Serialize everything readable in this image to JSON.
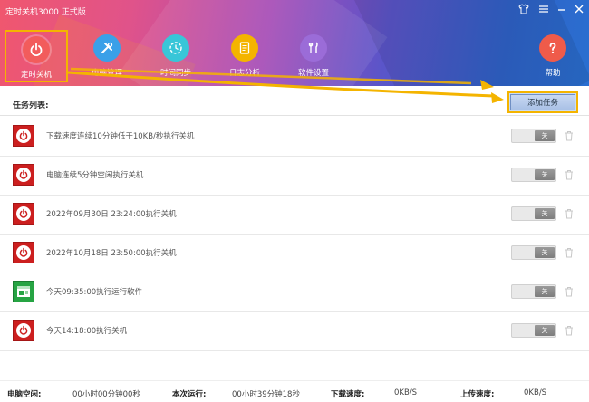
{
  "window": {
    "title": "定时关机3000 正式版",
    "controls": [
      "shirt-icon",
      "menu-icon",
      "minimize-icon",
      "close-icon"
    ]
  },
  "nav": [
    {
      "id": "shutdown",
      "label": "定时关机",
      "icon": "power-icon",
      "active": true
    },
    {
      "id": "pc",
      "label": "电脑管理",
      "icon": "tools-icon"
    },
    {
      "id": "timesync",
      "label": "时间同步",
      "icon": "clock-sync-icon"
    },
    {
      "id": "log",
      "label": "日志分析",
      "icon": "log-doc-icon"
    },
    {
      "id": "settings",
      "label": "软件设置",
      "icon": "wrench-spoon-icon"
    },
    {
      "id": "help",
      "label": "帮助",
      "icon": "question-icon"
    }
  ],
  "task_list": {
    "title": "任务列表:",
    "add_button": "添加任务",
    "rows": [
      {
        "type": "power",
        "text": "下载速度连续10分钟低于10KB/秒执行关机",
        "toggle": "关"
      },
      {
        "type": "power",
        "text": "电脑连续5分钟空闲执行关机",
        "toggle": "关"
      },
      {
        "type": "power",
        "text": "2022年09月30日 23:24:00执行关机",
        "toggle": "关"
      },
      {
        "type": "power",
        "text": "2022年10月18日 23:50:00执行关机",
        "toggle": "关"
      },
      {
        "type": "software",
        "text": "今天09:35:00执行运行软件",
        "toggle": "关"
      },
      {
        "type": "power",
        "text": "今天14:18:00执行关机",
        "toggle": "关"
      }
    ]
  },
  "status": {
    "idle_label": "电脑空闲:",
    "idle_value": "00小时00分钟00秒",
    "run_label": "本次运行:",
    "run_value": "00小时39分钟18秒",
    "down_label": "下载速度:",
    "down_value": "0KB/S",
    "up_label": "上传速度:",
    "up_value": "0KB/S"
  },
  "colors": {
    "accent_highlight": "#f4b400",
    "power_red": "#cc1f1f",
    "software_green": "#26a443"
  }
}
